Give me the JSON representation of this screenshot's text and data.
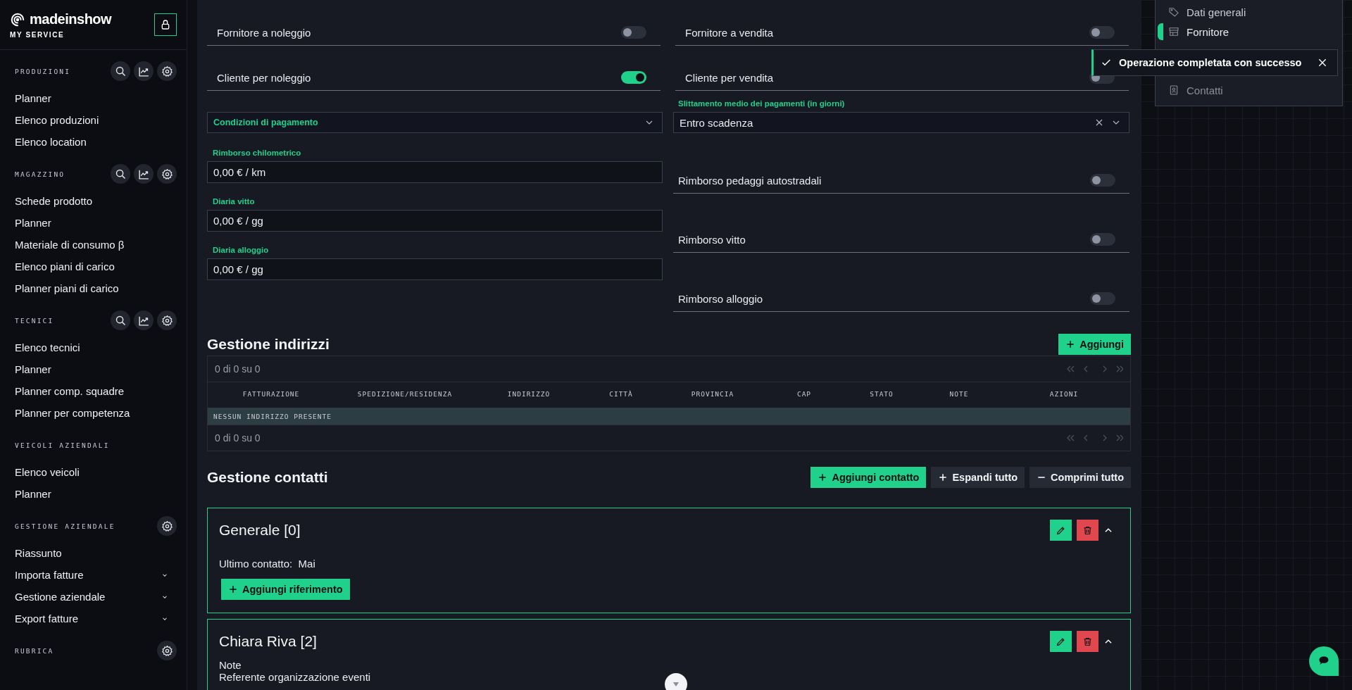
{
  "brand": {
    "logo": "madeinshow",
    "subtitle": "MY SERVICE"
  },
  "sidebar": {
    "sections": [
      {
        "title": "PRODUZIONI",
        "kind": "full",
        "items": [
          {
            "label": "Planner",
            "expandable": false
          },
          {
            "label": "Elenco produzioni",
            "expandable": false
          },
          {
            "label": "Elenco location",
            "expandable": false
          }
        ]
      },
      {
        "title": "MAGAZZINO",
        "kind": "full",
        "items": [
          {
            "label": "Schede prodotto",
            "expandable": false
          },
          {
            "label": "Planner",
            "expandable": false
          },
          {
            "label": "Materiale di consumo β",
            "expandable": false
          },
          {
            "label": "Elenco piani di carico",
            "expandable": false
          },
          {
            "label": "Planner piani di carico",
            "expandable": false
          }
        ]
      },
      {
        "title": "TECNICI",
        "kind": "full",
        "items": [
          {
            "label": "Elenco tecnici",
            "expandable": false
          },
          {
            "label": "Planner",
            "expandable": false
          },
          {
            "label": "Planner comp. squadre",
            "expandable": false
          },
          {
            "label": "Planner per competenza",
            "expandable": false
          }
        ]
      },
      {
        "title": "VEICOLI AZIENDALI",
        "kind": "plain",
        "items": [
          {
            "label": "Elenco veicoli",
            "expandable": false
          },
          {
            "label": "Planner",
            "expandable": false
          }
        ]
      },
      {
        "title": "GESTIONE AZIENDALE",
        "kind": "settings",
        "items": [
          {
            "label": "Riassunto",
            "expandable": false
          },
          {
            "label": "Importa fatture",
            "expandable": true
          },
          {
            "label": "Gestione aziendale",
            "expandable": true
          },
          {
            "label": "Export fatture",
            "expandable": true
          }
        ]
      },
      {
        "title": "RUBRICA",
        "kind": "settings"
      }
    ]
  },
  "switch_rows": [
    {
      "label": "Fornitore a noleggio",
      "on": false
    },
    {
      "label": "Fornitore a vendita",
      "on": false
    },
    {
      "label": "Cliente per noleggio",
      "on": true
    },
    {
      "label": "Cliente per vendita",
      "on": false
    }
  ],
  "payment_terms": {
    "label": "Condizioni di pagamento"
  },
  "payment_delay": {
    "label": "Slittamento medio dei pagamenti (in giorni)",
    "value": "Entro scadenza"
  },
  "amount_fields": [
    {
      "label": "Rimborso chilometrico",
      "value": "0,00 € / km"
    },
    {
      "label": "Diaria vitto",
      "value": "0,00 € / gg"
    },
    {
      "label": "Diaria alloggio",
      "value": "0,00 € / gg"
    }
  ],
  "reimbursement_toggles": [
    {
      "label": "Rimborso pedaggi autostradali",
      "on": false
    },
    {
      "label": "Rimborso vitto",
      "on": false
    },
    {
      "label": "Rimborso alloggio",
      "on": false
    }
  ],
  "addresses": {
    "title": "Gestione indirizzi",
    "add_button": "Aggiungi",
    "pager_top": "0 di 0 su 0",
    "columns": [
      "FATTURAZIONE",
      "SPEDIZIONE/RESIDENZA",
      "INDIRIZZO",
      "CITTÀ",
      "PROVINCIA",
      "CAP",
      "STATO",
      "NOTE",
      "AZIONI"
    ],
    "empty_text": "NESSUN INDIRIZZO PRESENTE",
    "pager_bottom": "0 di 0 su 0"
  },
  "contacts": {
    "title": "Gestione contatti",
    "buttons": [
      {
        "label": "Aggiungi contatto",
        "kind": "add"
      },
      {
        "label": "Espandi tutto",
        "kind": "expand"
      },
      {
        "label": "Comprimi tutto",
        "kind": "collapse"
      }
    ],
    "cards": [
      {
        "title": "Generale [0]",
        "expanded": true,
        "last_contact_label": "Ultimo contatto:",
        "last_contact_value": "Mai",
        "add_reference": "Aggiungi riferimento"
      },
      {
        "title": "Chiara Riva [2]",
        "expanded": true,
        "note_label": "Note",
        "note_text": "Referente organizzazione eventi"
      }
    ]
  },
  "section_nav": {
    "items": [
      {
        "label": "Dati generali",
        "selected": false
      },
      {
        "label": "Fornitore",
        "selected": true
      },
      {
        "label": "Contatti",
        "selected": false
      }
    ]
  },
  "toast": {
    "message": "Operazione completata con successo"
  }
}
